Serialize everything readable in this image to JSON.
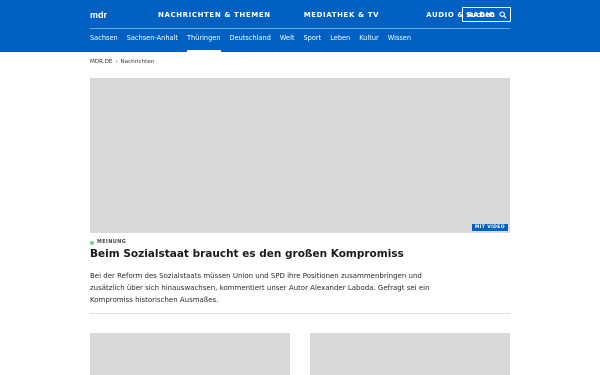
{
  "header": {
    "logo_text": "mdr",
    "main_nav": [
      "NACHRICHTEN & THEMEN",
      "MEDIATHEK & TV",
      "AUDIO & RADIO"
    ],
    "search_label": "Suchen",
    "sub_nav": [
      "Sachsen",
      "Sachsen-Anhalt",
      "Thüringen",
      "Deutschland",
      "Welt",
      "Sport",
      "Leben",
      "Kultur",
      "Wissen"
    ],
    "colors": {
      "brand": "#0061c2",
      "text": "#ffffff"
    }
  },
  "breadcrumb": [
    "MDR.DE",
    "Nachrichten"
  ],
  "article": {
    "video_badge": "MIT VIDEO",
    "kicker": "MEINUNG",
    "headline": "Beim Sozialstaat braucht es den großen Kompromiss",
    "teaser": "Bei der Reform des Sozialstaats müssen Union und SPD ihre Positionen zusammenbringen und zusätzlich über sich hinauswachsen, kommentiert unser Autor Alexander Laboda. Gefragt sei ein Kompromiss historischen Ausmaßes."
  },
  "icons": {
    "search": "search-icon",
    "breadcrumb_separator": "chevron-right-icon",
    "kicker_dot": "status-dot-icon"
  }
}
